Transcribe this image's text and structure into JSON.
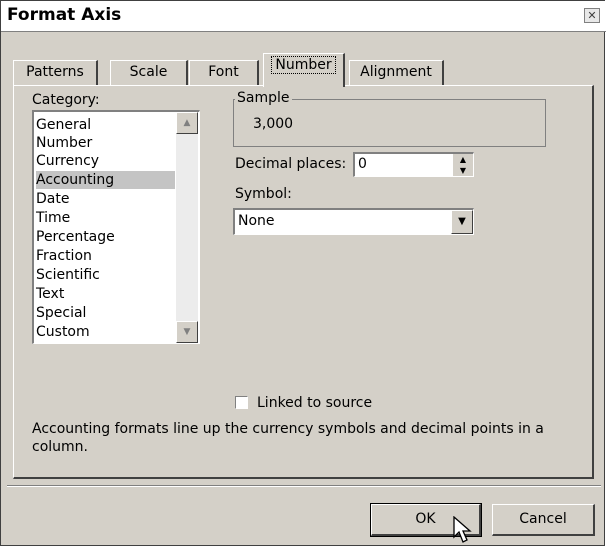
{
  "window": {
    "title": "Format Axis",
    "close_icon": "close-icon"
  },
  "tabs": [
    {
      "label": "Patterns",
      "active": false
    },
    {
      "label": "Scale",
      "active": false
    },
    {
      "label": "Font",
      "active": false
    },
    {
      "label": "Number",
      "active": true
    },
    {
      "label": "Alignment",
      "active": false
    }
  ],
  "category": {
    "label": "Category:",
    "items": [
      "General",
      "Number",
      "Currency",
      "Accounting",
      "Date",
      "Time",
      "Percentage",
      "Fraction",
      "Scientific",
      "Text",
      "Special",
      "Custom"
    ],
    "selected": "Accounting"
  },
  "sample": {
    "label": "Sample",
    "value": "3,000"
  },
  "decimal_places": {
    "label": "Decimal places:",
    "value": "0"
  },
  "symbol": {
    "label": "Symbol:",
    "value": "None"
  },
  "linked": {
    "label": "Linked to source",
    "checked": false
  },
  "description": "Accounting formats line up the currency symbols and decimal points in a column.",
  "buttons": {
    "ok": "OK",
    "cancel": "Cancel"
  }
}
